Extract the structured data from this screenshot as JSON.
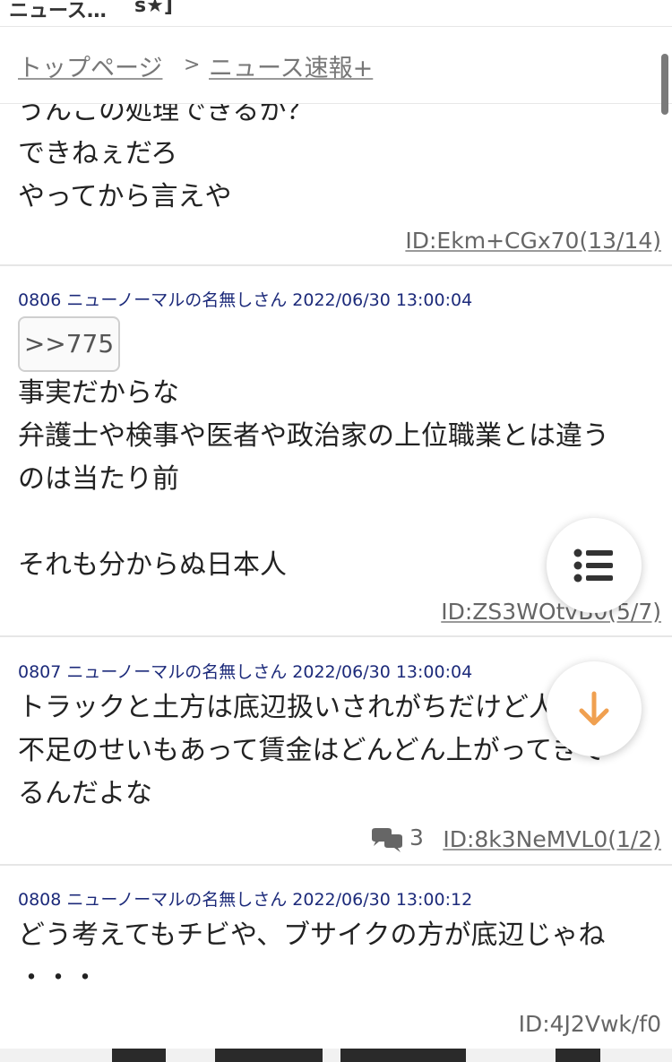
{
  "top_bar": {
    "title": "ニュース…",
    "suffix": "s★]"
  },
  "breadcrumb": {
    "home": "トップページ",
    "separator": ">",
    "board": "ニュース速報+"
  },
  "previous_post": {
    "lines": [
      "うんこの処理できるか？",
      "できねぇだろ",
      "やってから言えや"
    ],
    "id": "ID:Ekm+CGx70(13/14)"
  },
  "posts": [
    {
      "header": "0806 ニューノーマルの名無しさん 2022/06/30 13:00:04",
      "anchor": ">>775",
      "lines": [
        "事実だからな",
        "弁護士や検事や医者や政治家の上位職業とは違う",
        "のは当たり前",
        "",
        "それも分からぬ日本人"
      ],
      "id": "ID:ZS3WOtvB0(5/7)"
    },
    {
      "header": "0807 ニューノーマルの名無しさん 2022/06/30 13:00:04",
      "lines": [
        "トラックと土方は底辺扱いされがちだけど人手",
        "不足のせいもあって賃金はどんどん上がってきて",
        "るんだよな"
      ],
      "reply_count": "3",
      "id": "ID:8k3NeMVL0(1/2)"
    },
    {
      "header": "0808 ニューノーマルの名無しさん 2022/06/30 13:00:12",
      "lines": [
        "どう考えてもチビや、ブサイクの方が底辺じゃね",
        "・・・"
      ],
      "id": "ID:4J2Vwk/f0"
    }
  ],
  "icons": {
    "menu": "list-icon",
    "scroll_down": "arrow-down-icon",
    "replies": "speech-bubbles-icon"
  },
  "colors": {
    "header_text": "#1c2a7a",
    "arrow_accent": "#f0a050",
    "id_text": "#666666"
  }
}
